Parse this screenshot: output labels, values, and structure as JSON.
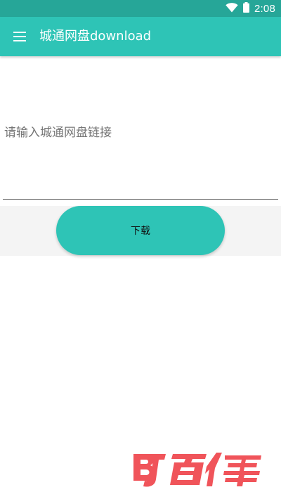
{
  "status_bar": {
    "time": "2:08",
    "icons": [
      "wifi-icon",
      "battery-icon"
    ],
    "background": "#26a698"
  },
  "app_bar": {
    "title": "城通网盘download",
    "menu_icon": "hamburger-menu-icon",
    "background": "#2ec4b6"
  },
  "link_input": {
    "placeholder": "请输入城通网盘链接",
    "value": ""
  },
  "download_button": {
    "label": "下载",
    "color": "#2ec4b6"
  },
  "watermark": {
    "text": "百佳",
    "logo_letters": "BJ",
    "color": "#f0545a"
  }
}
